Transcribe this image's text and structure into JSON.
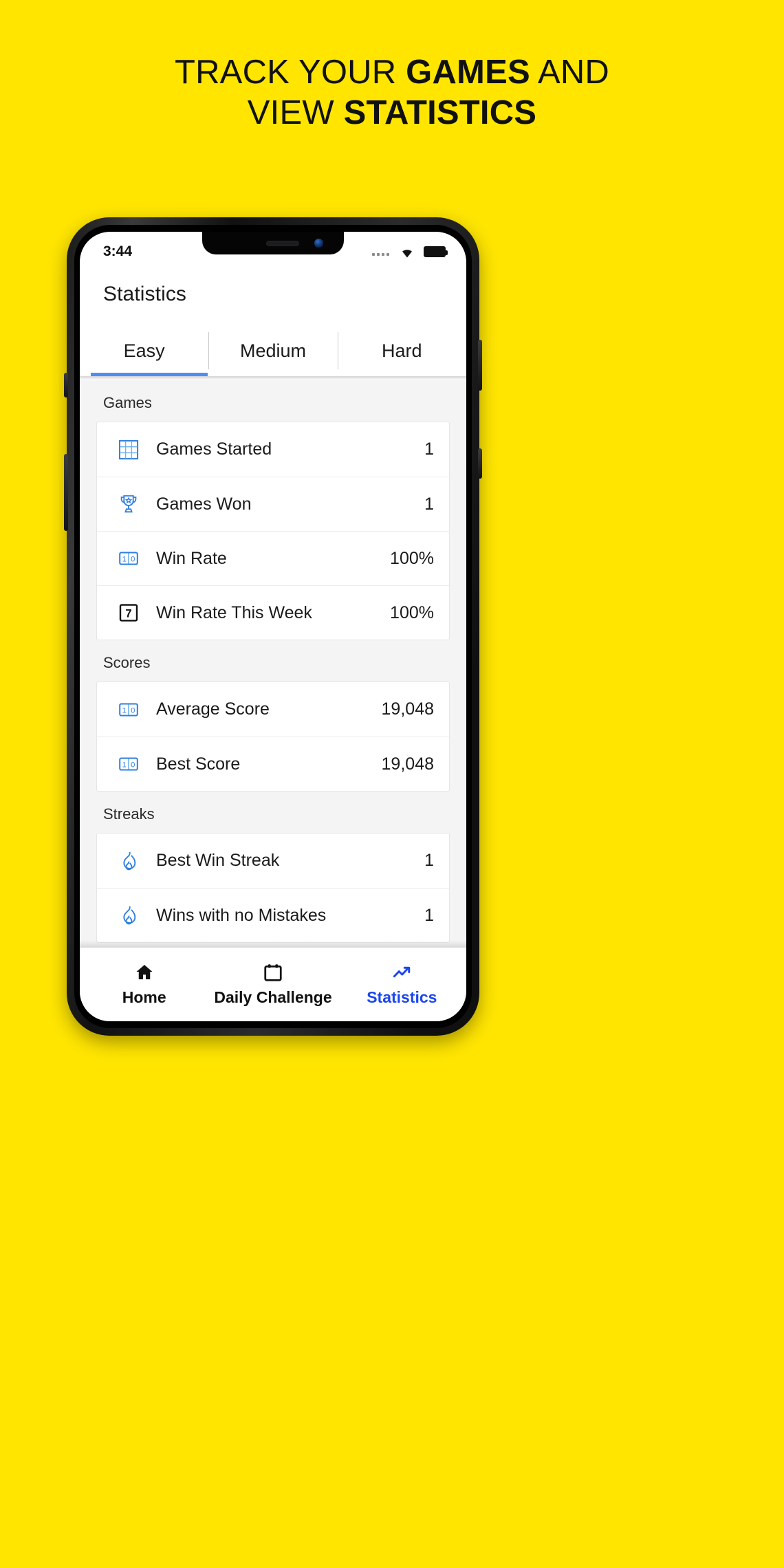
{
  "promo": {
    "background_color": "#FFE500",
    "headline_line1_prefix": "TRACK YOUR ",
    "headline_line1_bold": "GAMES",
    "headline_line1_suffix": " AND",
    "headline_line2_prefix": "VIEW ",
    "headline_line2_bold": "STATISTICS"
  },
  "status_bar": {
    "time": "3:44",
    "signal_icon": "signal-dots-icon",
    "wifi_icon": "wifi-icon",
    "battery_icon": "battery-full-icon"
  },
  "app": {
    "title": "Statistics",
    "accent_color": "#4f8df5",
    "active_nav_color": "#1b46f0"
  },
  "tabs": [
    {
      "label": "Easy",
      "active": true
    },
    {
      "label": "Medium",
      "active": false
    },
    {
      "label": "Hard",
      "active": false
    }
  ],
  "sections": [
    {
      "title": "Games",
      "rows": [
        {
          "icon": "sudoku-grid-icon",
          "label": "Games Started",
          "value": "1"
        },
        {
          "icon": "trophy-icon",
          "label": "Games Won",
          "value": "1"
        },
        {
          "icon": "input-numbers-icon",
          "label": "Win Rate",
          "value": "100%"
        },
        {
          "icon": "calendar-seven-icon",
          "label": "Win Rate This Week",
          "value": "100%"
        }
      ]
    },
    {
      "title": "Scores",
      "rows": [
        {
          "icon": "input-numbers-icon",
          "label": "Average Score",
          "value": "19,048"
        },
        {
          "icon": "input-numbers-icon",
          "label": "Best Score",
          "value": "19,048"
        }
      ]
    },
    {
      "title": "Streaks",
      "rows": [
        {
          "icon": "flame-icon",
          "label": "Best Win Streak",
          "value": "1"
        },
        {
          "icon": "flame-icon",
          "label": "Wins with no Mistakes",
          "value": "1"
        }
      ]
    }
  ],
  "bottom_nav": [
    {
      "label": "Home",
      "icon": "home-icon",
      "active": false
    },
    {
      "label": "Daily Challenge",
      "icon": "calendar-icon",
      "active": false
    },
    {
      "label": "Statistics",
      "icon": "trending-up-icon",
      "active": true
    }
  ]
}
